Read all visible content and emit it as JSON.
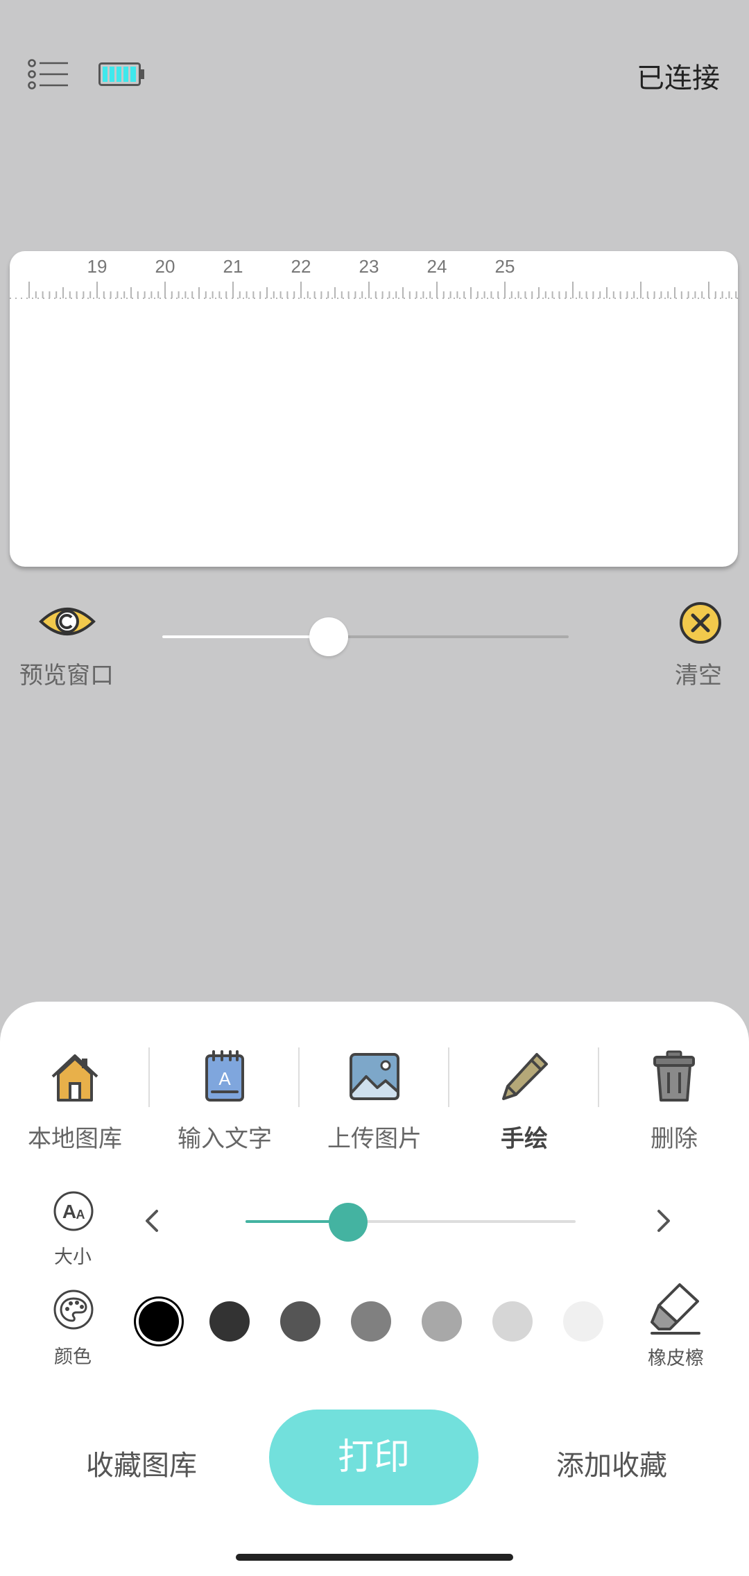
{
  "header": {
    "status": "已连接",
    "icons": {
      "menu": "list-icon",
      "battery": "battery-icon"
    },
    "battery_color": "#3fe8ec"
  },
  "ruler": {
    "labels": [
      "19",
      "20",
      "21",
      "22",
      "23",
      "24",
      "25"
    ]
  },
  "preview": {
    "label": "预览窗口",
    "icon": "eye-icon",
    "zoom_level": 0.41
  },
  "clear": {
    "label": "清空",
    "icon": "close-circle-icon"
  },
  "tools": [
    {
      "label": "本地图库",
      "icon": "home-icon"
    },
    {
      "label": "输入文字",
      "icon": "notepad-text-icon"
    },
    {
      "label": "上传图片",
      "icon": "image-icon"
    },
    {
      "label": "手绘",
      "icon": "pencil-icon",
      "active": true
    },
    {
      "label": "删除",
      "icon": "trash-icon"
    }
  ],
  "size": {
    "label": "大小",
    "icon": "font-size-icon",
    "value": 0.31,
    "accent": "#44b3a1"
  },
  "color": {
    "label": "颜色",
    "icon": "palette-icon",
    "swatches": [
      "#000000",
      "#333333",
      "#555555",
      "#808080",
      "#a8a8a8",
      "#d6d6d6",
      "#f0f0f0"
    ],
    "selected_index": 0
  },
  "eraser": {
    "label": "橡皮檫",
    "icon": "eraser-icon"
  },
  "footer": {
    "favorites_library": "收藏图库",
    "print": "打印",
    "add_favorite": "添加收藏",
    "print_color": "#72e0dc"
  }
}
